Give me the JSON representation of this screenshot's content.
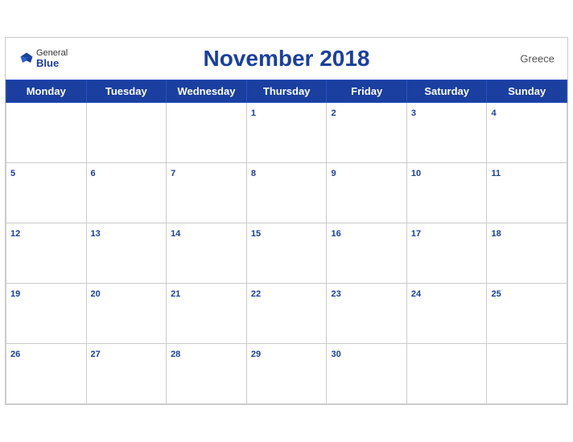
{
  "calendar": {
    "month_year": "November 2018",
    "country": "Greece",
    "logo": {
      "general": "General",
      "blue": "Blue"
    },
    "days_of_week": [
      "Monday",
      "Tuesday",
      "Wednesday",
      "Thursday",
      "Friday",
      "Saturday",
      "Sunday"
    ],
    "weeks": [
      [
        null,
        null,
        null,
        1,
        2,
        3,
        4
      ],
      [
        5,
        6,
        7,
        8,
        9,
        10,
        11
      ],
      [
        12,
        13,
        14,
        15,
        16,
        17,
        18
      ],
      [
        19,
        20,
        21,
        22,
        23,
        24,
        25
      ],
      [
        26,
        27,
        28,
        29,
        30,
        null,
        null
      ]
    ]
  }
}
